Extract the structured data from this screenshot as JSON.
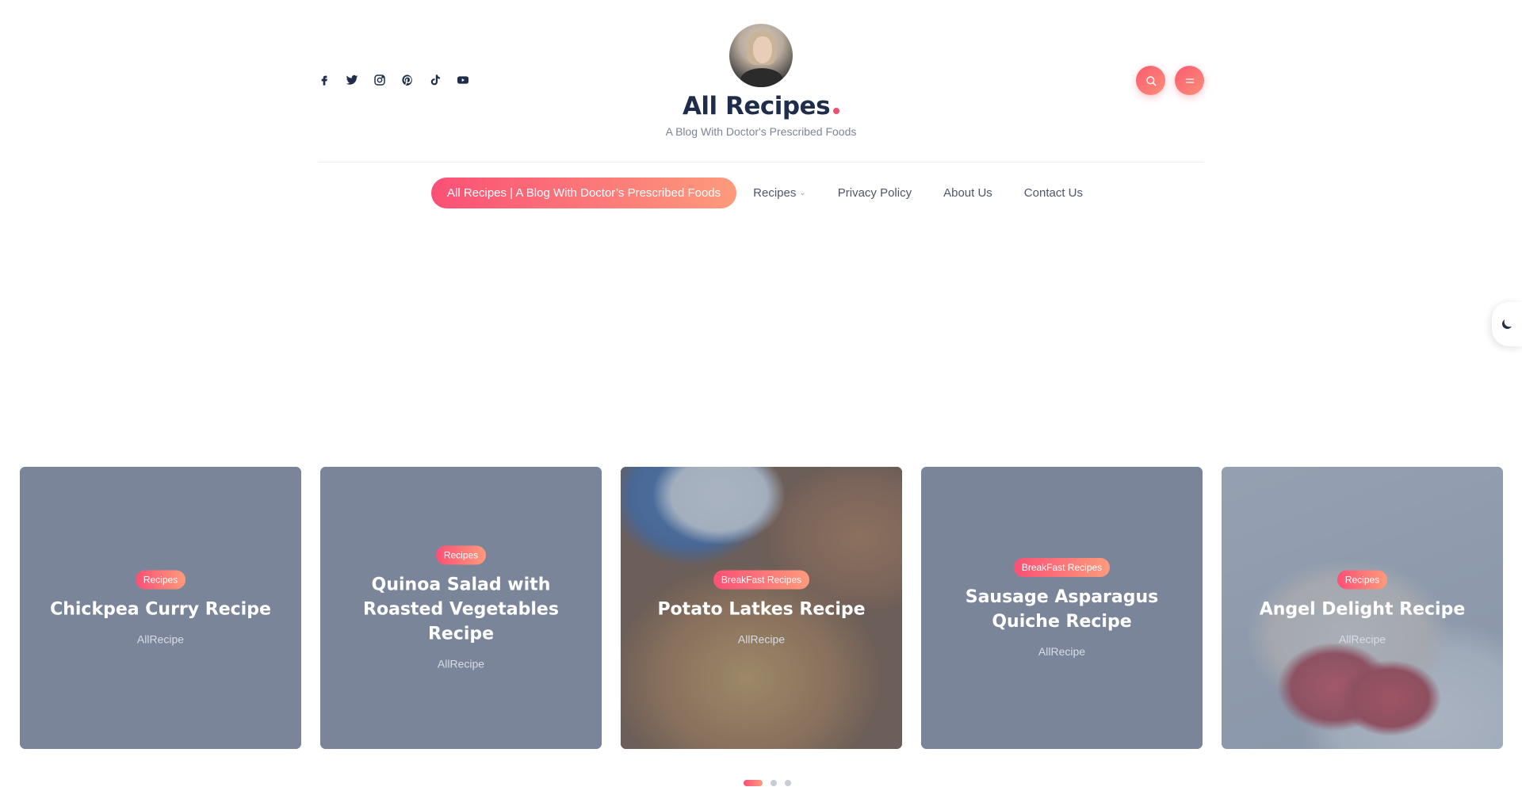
{
  "header": {
    "site_title": "All Recipes",
    "tagline": "A Blog With Doctor's Prescribed Foods",
    "socials": [
      "facebook-icon",
      "twitter-icon",
      "instagram-icon",
      "pinterest-icon",
      "tiktok-icon",
      "youtube-icon"
    ],
    "actions": [
      "search-icon",
      "menu-icon"
    ]
  },
  "nav": {
    "items": [
      {
        "label": "All Recipes | A Blog With Doctor’s Prescribed Foods",
        "active": true
      },
      {
        "label": "Recipes",
        "dropdown": true
      },
      {
        "label": "Privacy Policy"
      },
      {
        "label": "About Us"
      },
      {
        "label": "Contact Us"
      }
    ]
  },
  "theme_toggle": {
    "icon": "moon-icon"
  },
  "slider": {
    "cards": [
      {
        "category": "Recipes",
        "title": "Chickpea Curry Recipe",
        "author": "AllRecipe"
      },
      {
        "category": "Recipes",
        "title": "Quinoa Salad with Roasted Vegetables Recipe",
        "author": "AllRecipe"
      },
      {
        "category": "BreakFast Recipes",
        "title": "Potato Latkes Recipe",
        "author": "AllRecipe"
      },
      {
        "category": "BreakFast Recipes",
        "title": "Sausage Asparagus Quiche Recipe",
        "author": "AllRecipe"
      },
      {
        "category": "Recipes",
        "title": "Angel Delight Recipe",
        "author": "AllRecipe"
      }
    ],
    "active_page": 1,
    "page_count": 3
  },
  "colors": {
    "accent_start": "#fb5075",
    "accent_end": "#fd9b7c",
    "title": "#1f2d4a",
    "muted": "#7d8595"
  }
}
